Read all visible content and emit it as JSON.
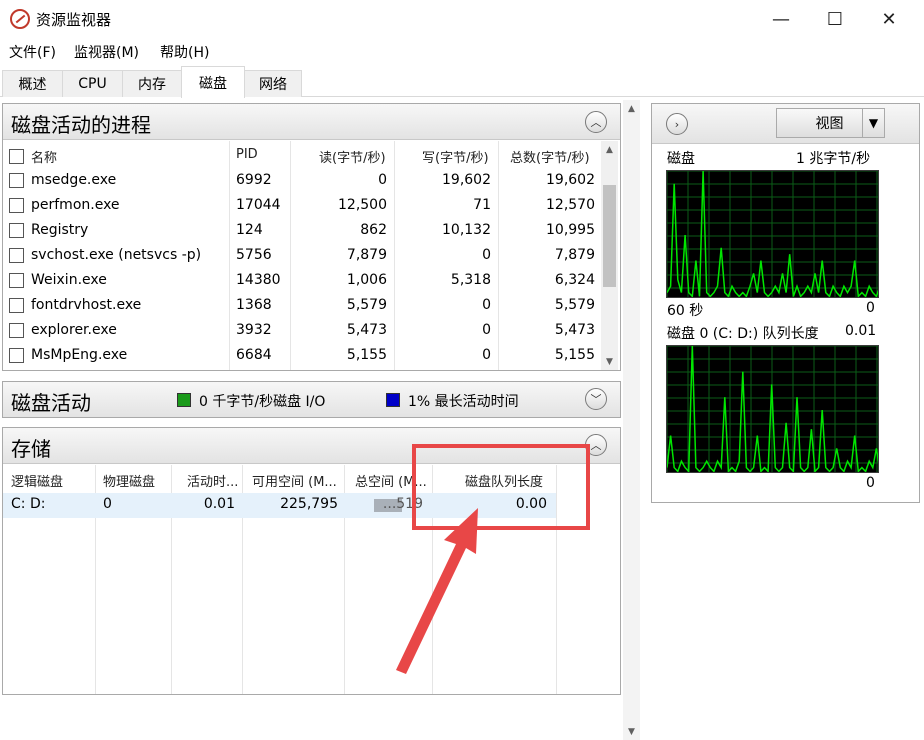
{
  "window": {
    "title": "资源监视器",
    "minimize_glyph": "—",
    "maximize_glyph": "☐",
    "close_glyph": "✕"
  },
  "menu": [
    "文件(F)",
    "监视器(M)",
    "帮助(H)"
  ],
  "tabs": [
    "概述",
    "CPU",
    "内存",
    "磁盘",
    "网络"
  ],
  "active_tab": "磁盘",
  "processes_panel": {
    "title": "磁盘活动的进程",
    "columns": [
      "名称",
      "PID",
      "读(字节/秒)",
      "写(字节/秒)",
      "总数(字节/秒)"
    ],
    "rows": [
      [
        "msedge.exe",
        "6992",
        "0",
        "19,602",
        "19,602"
      ],
      [
        "perfmon.exe",
        "17044",
        "12,500",
        "71",
        "12,570"
      ],
      [
        "Registry",
        "124",
        "862",
        "10,132",
        "10,995"
      ],
      [
        "svchost.exe (netsvcs -p)",
        "5756",
        "7,879",
        "0",
        "7,879"
      ],
      [
        "Weixin.exe",
        "14380",
        "1,006",
        "5,318",
        "6,324"
      ],
      [
        "fontdrvhost.exe",
        "1368",
        "5,579",
        "0",
        "5,579"
      ],
      [
        "explorer.exe",
        "3932",
        "5,473",
        "0",
        "5,473"
      ],
      [
        "MsMpEng.exe",
        "6684",
        "5,155",
        "0",
        "5,155"
      ]
    ]
  },
  "disk_activity_panel": {
    "title": "磁盘活动",
    "io_text": "0 千字节/秒磁盘 I/O",
    "active_time_text": "1% 最长活动时间",
    "io_color": "#1a9a1a",
    "active_time_color": "#0000c8"
  },
  "storage_panel": {
    "title": "存储",
    "columns": [
      "逻辑磁盘",
      "物理磁盘",
      "活动时...",
      "可用空间 (M...",
      "总空间 (M...",
      "磁盘队列长度"
    ],
    "rows": [
      [
        "C: D:",
        "0",
        "0.01",
        "225,795",
        "...519",
        "0.00"
      ]
    ]
  },
  "right_panel": {
    "view_button": "视图",
    "graph1": {
      "title": "磁盘",
      "scale": "1 兆字节/秒",
      "time_label": "60 秒",
      "min_label": "0"
    },
    "graph2": {
      "title": "磁盘 0 (C: D:) 队列长度",
      "scale": "0.01",
      "min_label": "0"
    }
  },
  "colors": {
    "graph_line": "#00e600",
    "graph_grid": "#0b5d17",
    "annotation": "#e84747"
  }
}
